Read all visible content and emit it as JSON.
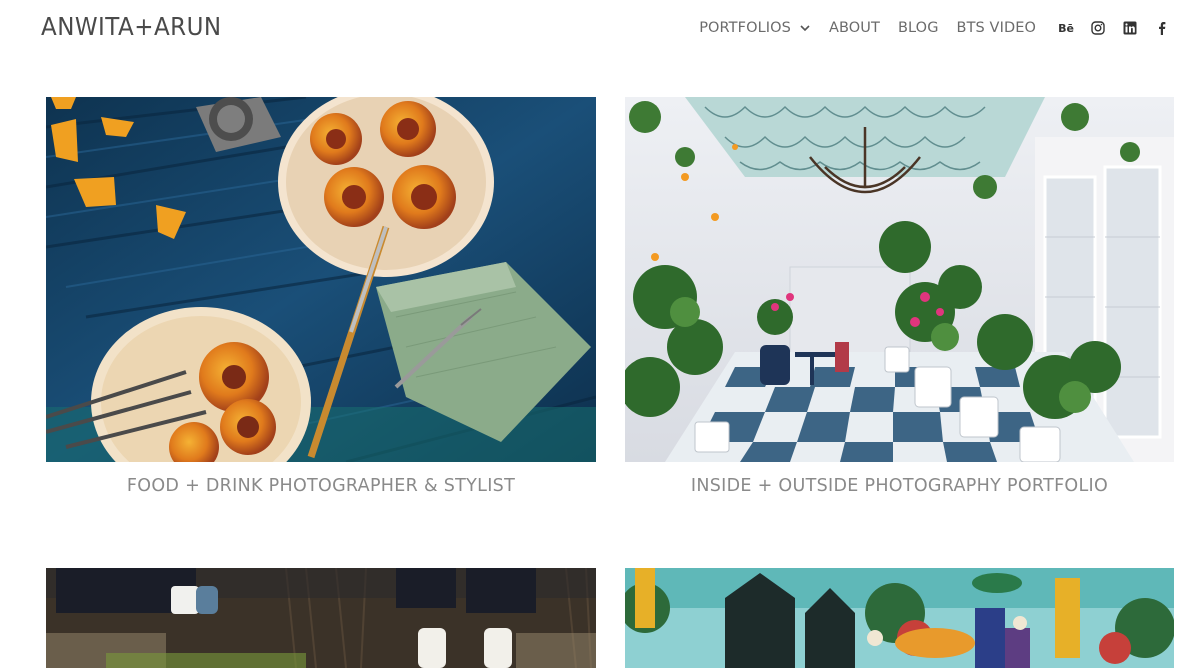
{
  "header": {
    "logo": "ANWITA+ARUN",
    "nav": {
      "portfolios": "PORTFOLIOS",
      "about": "ABOUT",
      "blog": "BLOG",
      "bts_video": "BTS VIDEO"
    },
    "social": {
      "behance": "Bē",
      "icons": [
        "behance-icon",
        "instagram-icon",
        "linkedin-icon",
        "facebook-icon"
      ]
    }
  },
  "portfolio": {
    "items": [
      {
        "caption": "FOOD + DRINK PHOTOGRAPHER & STYLIST",
        "image": "food-photo"
      },
      {
        "caption": "INSIDE + OUTSIDE PHOTOGRAPHY PORTFOLIO",
        "image": "interior-photo"
      },
      {
        "caption": "",
        "image": "people-photo"
      },
      {
        "caption": "",
        "image": "illustration-photo"
      }
    ]
  },
  "colors": {
    "text": "#4a4a4a",
    "nav": "#6b6b6b",
    "caption": "#8a8a8a",
    "background": "#ffffff"
  }
}
